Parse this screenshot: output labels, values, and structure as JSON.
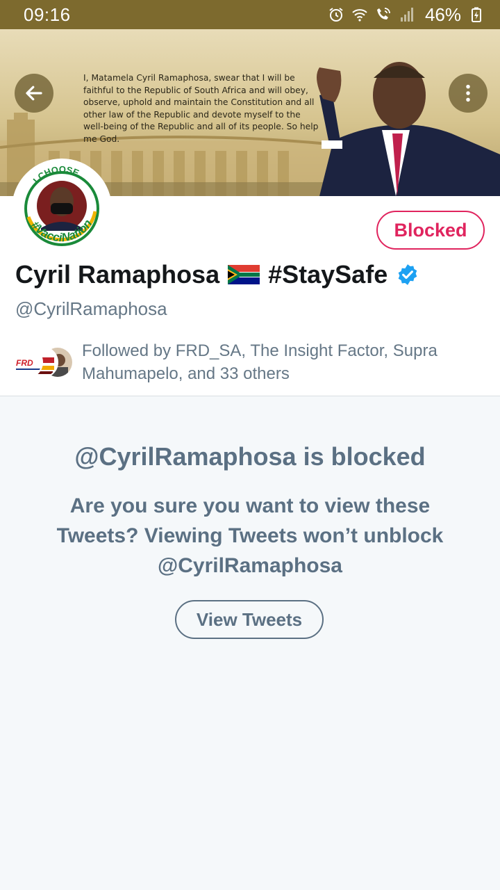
{
  "status_bar": {
    "time": "09:16",
    "battery": "46%",
    "icons": [
      "alarm-icon",
      "wifi-icon",
      "wifi-call-icon",
      "signal-icon",
      "battery-charging-icon"
    ]
  },
  "banner": {
    "oath": "I, Matamela Cyril Ramaphosa, swear that I will be faithful to the Republic of South Africa and will obey, observe, uphold and maintain the Constitution and all other law of the Republic and devote myself to the well-being of the Republic and all of its people. So help me God."
  },
  "avatar": {
    "top_text": "I CHOOSE",
    "bottom_text": "#VacciNation"
  },
  "profile": {
    "blocked_label": "Blocked",
    "name": "Cyril Ramaphosa",
    "hashtag": "#StaySafe",
    "handle": "@CyrilRamaphosa",
    "followed_by": "Followed by FRD_SA, The Insight Factor, Supra Mahumapelo, and 33 others",
    "follower_badge": "FRD"
  },
  "notice": {
    "title": "@CyrilRamaphosa is blocked",
    "body": "Are you sure you want to view these Tweets? Viewing Tweets won’t unblock @CyrilRamaphosa",
    "view_button": "View Tweets"
  },
  "colors": {
    "status_bar": "#7d6a2e",
    "blocked_red": "#e0245e",
    "muted": "#5b7083",
    "verified_blue": "#1da1f2"
  }
}
